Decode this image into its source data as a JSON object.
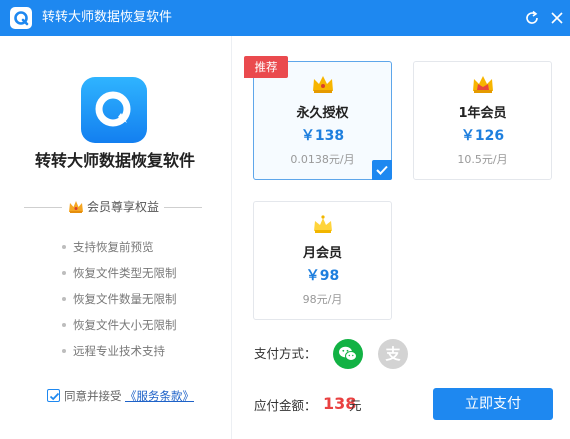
{
  "window": {
    "title": "转转大师数据恢复软件"
  },
  "app": {
    "name": "转转大师数据恢复软件"
  },
  "benefits": {
    "title": "会员尊享权益",
    "items": [
      "支持恢复前预览",
      "恢复文件类型无限制",
      "恢复文件数量无限制",
      "恢复文件大小无限制",
      "远程专业技术支持"
    ]
  },
  "agreement": {
    "text": "同意并接受",
    "link": "《服务条款》",
    "checked": true
  },
  "plans": [
    {
      "name": "永久授权",
      "price": "￥138",
      "per": "0.0138元/月",
      "badge": "推荐",
      "selected": true
    },
    {
      "name": "1年会员",
      "price": "￥126",
      "per": "10.5元/月",
      "selected": false
    },
    {
      "name": "月会员",
      "price": "￥98",
      "per": "98元/月",
      "selected": false
    }
  ],
  "payment": {
    "label": "支付方式：",
    "methods": [
      "wechat",
      "alipay"
    ],
    "alipay_glyph": "支"
  },
  "amount": {
    "label": "应付金额：",
    "value": "138",
    "unit": "元"
  },
  "pay_button": "立即支付",
  "colors": {
    "primary": "#1e88f0",
    "badge": "#ea4a4e",
    "amount": "#e94141",
    "wechat": "#12b244"
  }
}
